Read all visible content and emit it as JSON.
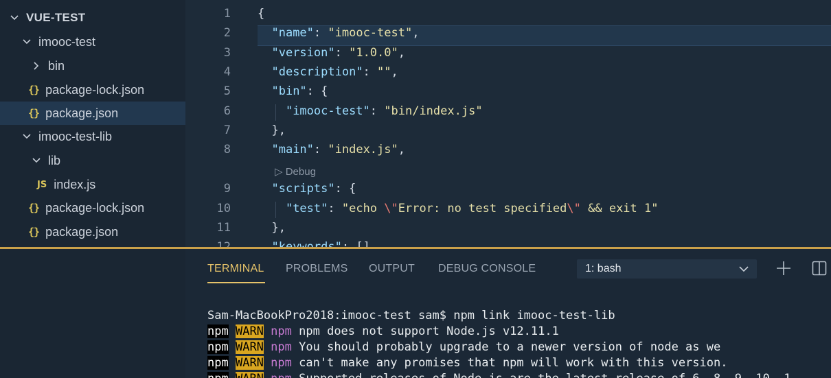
{
  "sidebar": {
    "root": "VUE-TEST",
    "items": [
      {
        "label": "imooc-test",
        "kind": "folder-open"
      },
      {
        "label": "bin",
        "kind": "folder-closed"
      },
      {
        "label": "package-lock.json",
        "kind": "json"
      },
      {
        "label": "package.json",
        "kind": "json",
        "selected": true
      },
      {
        "label": "imooc-test-lib",
        "kind": "folder-open"
      },
      {
        "label": "lib",
        "kind": "folder-open"
      },
      {
        "label": "index.js",
        "kind": "js"
      },
      {
        "label": "package-lock.json",
        "kind": "json"
      },
      {
        "label": "package.json",
        "kind": "json"
      }
    ],
    "json_icon": "{}",
    "js_icon": "JS"
  },
  "editor": {
    "line_numbers": [
      "1",
      "2",
      "3",
      "4",
      "5",
      "6",
      "7",
      "8",
      "9",
      "10",
      "11",
      "12"
    ],
    "codelens": "Debug",
    "lines": {
      "l1": "{",
      "l2_key": "\"name\"",
      "l2_val": "\"imooc-test\"",
      "l3_key": "\"version\"",
      "l3_val": "\"1.0.0\"",
      "l4_key": "\"description\"",
      "l4_val": "\"\"",
      "l5_key": "\"bin\"",
      "l6_key": "\"imooc-test\"",
      "l6_val": "\"bin/index.js\"",
      "l7": "},",
      "l8_key": "\"main\"",
      "l8_val": "\"index.js\"",
      "l9_key": "\"scripts\"",
      "l10_key": "\"test\"",
      "l10_val_a": "\"echo ",
      "l10_esc1": "\\\"",
      "l10_val_b": "Error: no test specified",
      "l10_esc2": "\\\"",
      "l10_val_c": " && exit 1\"",
      "l11": "},",
      "l12_key": "\"keywords\"",
      "l12_val": "[]"
    }
  },
  "panel": {
    "tabs": [
      "TERMINAL",
      "PROBLEMS",
      "OUTPUT",
      "DEBUG CONSOLE"
    ],
    "active_tab": "TERMINAL",
    "terminal_select": "1: bash",
    "terminal": {
      "prompt": "Sam-MacBookPro2018:imooc-test sam$ npm link imooc-test-lib",
      "npm": "npm",
      "warn": "WARN",
      "warnings": [
        "npm does not support Node.js v12.11.1",
        "You should probably upgrade to a newer version of node as we",
        "can't make any promises that npm will work with this version.",
        "Supported releases of Node.js are the latest release of 6, 8, 9, 10, 1"
      ]
    }
  },
  "colors": {
    "accent": "#e6c36a",
    "warn_bg": "#d9a620",
    "json_icon": "#d9c45a"
  }
}
